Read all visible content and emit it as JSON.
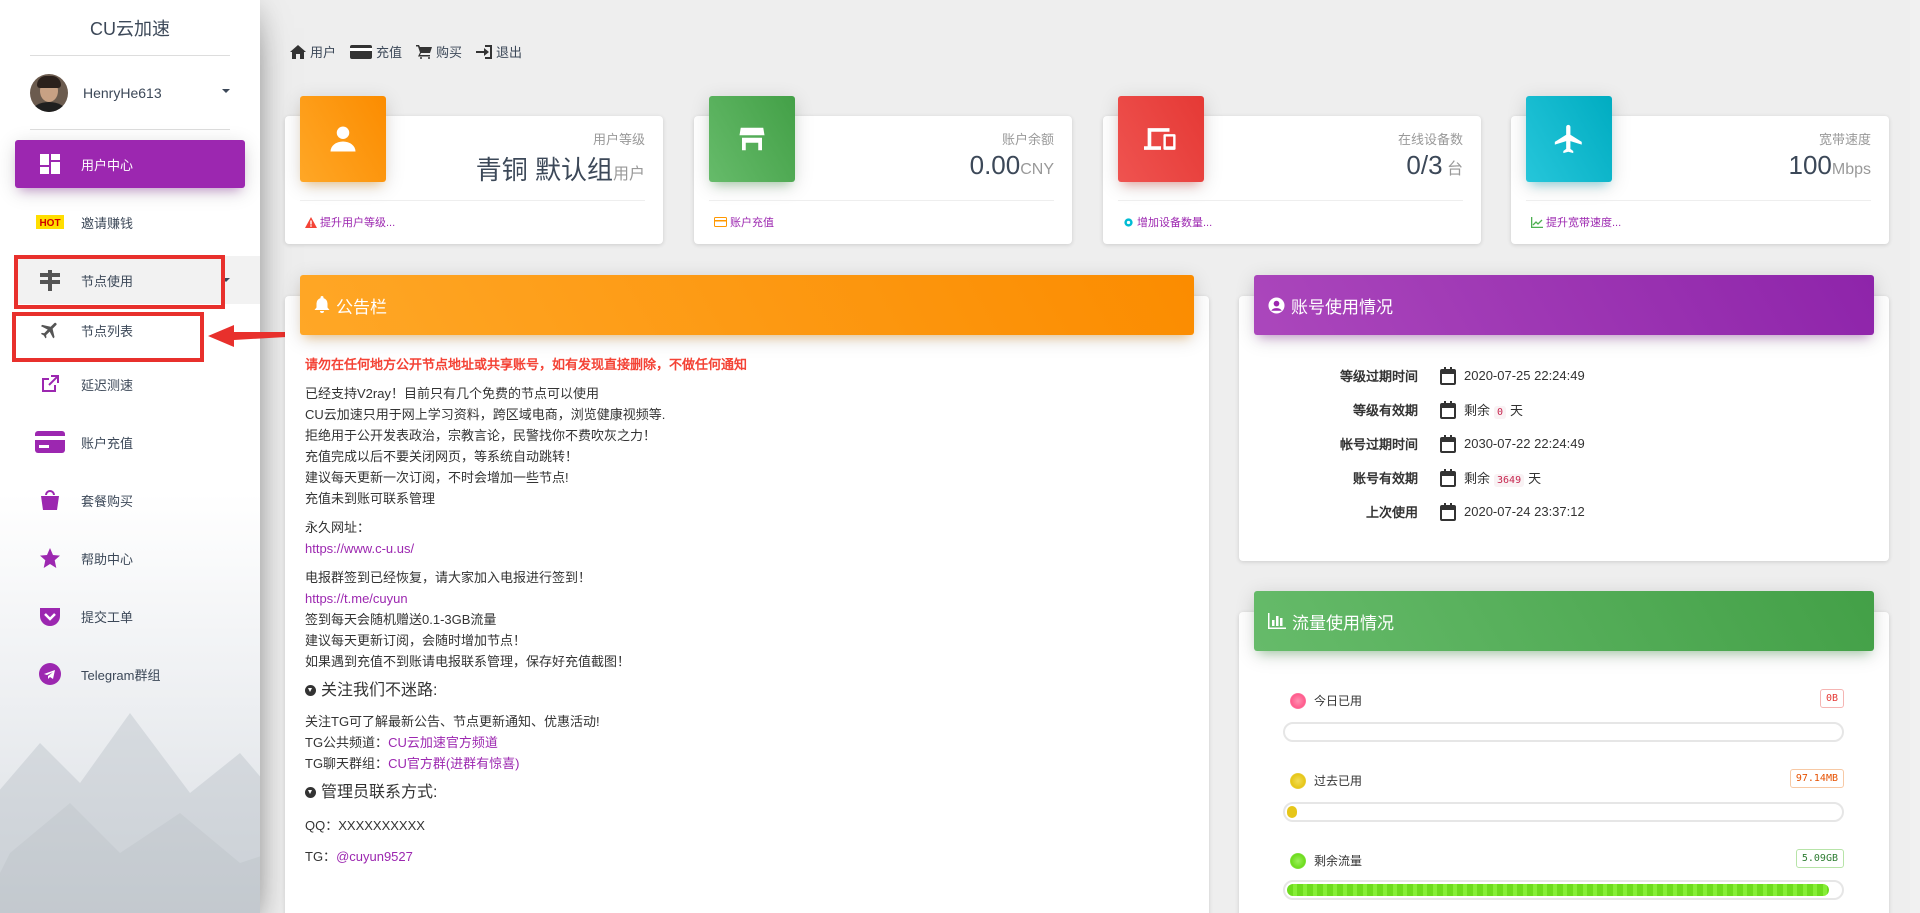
{
  "sidebar": {
    "logo": "CU云加速",
    "user": {
      "name": "HenryHe613"
    },
    "items": [
      {
        "label": "用户中心",
        "icon": "dashboard-icon",
        "active": true
      },
      {
        "label": "邀请赚钱",
        "icon": "hot-badge-icon",
        "badge": "HOT"
      },
      {
        "label": "节点使用",
        "icon": "signpost-icon",
        "expanded": true
      },
      {
        "label": "节点列表",
        "icon": "airplane-icon"
      },
      {
        "label": "延迟测速",
        "icon": "external-link-icon"
      },
      {
        "label": "账户充值",
        "icon": "credit-card-icon"
      },
      {
        "label": "套餐购买",
        "icon": "shopping-bag-icon"
      },
      {
        "label": "帮助中心",
        "icon": "star-icon"
      },
      {
        "label": "提交工单",
        "icon": "pocket-icon"
      },
      {
        "label": "Telegram群组",
        "icon": "telegram-icon"
      }
    ]
  },
  "top_links": [
    "用户",
    "充值",
    "购买",
    "退出"
  ],
  "stats": [
    {
      "category": "用户等级",
      "value": "青铜 默认组",
      "unit": "用户",
      "footer": "提升用户等级...",
      "color": "#ff9800",
      "icon": "person-icon",
      "footer_icon": "warning-icon"
    },
    {
      "category": "账户余额",
      "value": "0.00",
      "unit": "CNY",
      "footer": "账户充值",
      "color": "#4caf50",
      "icon": "store-icon",
      "footer_icon": "card-icon"
    },
    {
      "category": "在线设备数",
      "value": "0/3",
      "unit": " 台",
      "footer": "增加设备数量...",
      "color": "#f44336",
      "icon": "devices-icon",
      "footer_icon": "gear-icon"
    },
    {
      "category": "宽带速度",
      "value": "100",
      "unit": "Mbps",
      "footer": "提升宽带速度...",
      "color": "#00bcd4",
      "icon": "airplane-icon",
      "footer_icon": "chart-line-icon"
    }
  ],
  "announcement": {
    "title": "公告栏",
    "warning": "请勿在任何地方公开节点地址或共享账号，如有发现直接删除，不做任何通知",
    "paragraph1": [
      "已经支持V2ray！目前只有几个免费的节点可以使用",
      "CU云加速只用于网上学习资料，跨区域电商，浏览健康视频等.",
      "拒绝用于公开发表政治，宗教言论，民警找你不费吹灰之力！",
      "充值完成以后不要关闭网页，等系统自动跳转！",
      "建议每天更新一次订阅，不时会增加一些节点!",
      "充值未到账可联系管理"
    ],
    "permanent_label": "永久网址：",
    "permanent_url": "https://www.c-u.us/",
    "tg_intro": "电报群签到已经恢复，请大家加入电报进行签到！",
    "tg_url": "https://t.me/cuyun",
    "tg_lines": [
      "签到每天会随机赠送0.1-3GB流量",
      "建议每天更新订阅，会随时增加节点！",
      "如果遇到充值不到账请电报联系管理，保存好充值截图！"
    ],
    "follow_heading": "关注我们不迷路:",
    "follow_intro": "关注TG可了解最新公告、节点更新通知、优惠活动!",
    "channel_label": "TG公共频道：",
    "channel_link": "CU云加速官方频道",
    "group_label": "TG聊天群组：",
    "group_link": "CU官方群(进群有惊喜)",
    "contact_heading": "管理员联系方式:",
    "qq_label": "QQ：",
    "qq_value": "XXXXXXXXXX",
    "tg_label": "TG：",
    "tg_value": "@cuyun9527"
  },
  "account": {
    "title": "账号使用情况",
    "rows": [
      {
        "label": "等级过期时间",
        "value": "2020-07-25 22:24:49"
      },
      {
        "label": "等级有效期",
        "prefix": "剩余",
        "code": "0",
        "suffix": "天"
      },
      {
        "label": "帐号过期时间",
        "value": "2030-07-22 22:24:49"
      },
      {
        "label": "账号有效期",
        "prefix": "剩余",
        "code": "3649",
        "suffix": "天"
      },
      {
        "label": "上次使用",
        "value": "2020-07-24 23:37:12"
      }
    ]
  },
  "traffic": {
    "title": "流量使用情况",
    "items": [
      {
        "label": "今日已用",
        "value": "0B",
        "color": "#ff5c8d",
        "percent": 0
      },
      {
        "label": "过去已用",
        "value": "97.14MB",
        "color": "#e6c619",
        "percent": 2
      },
      {
        "label": "剩余流量",
        "value": "5.09GB",
        "color": "#6edc1e",
        "percent": 98
      }
    ]
  }
}
